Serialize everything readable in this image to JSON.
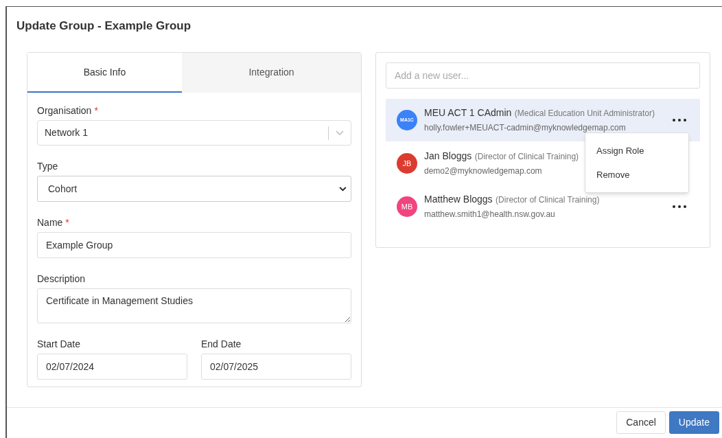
{
  "dialog": {
    "title": "Update Group - Example Group"
  },
  "tabs": [
    {
      "label": "Basic Info",
      "selected": true
    },
    {
      "label": "Integration",
      "selected": false
    }
  ],
  "form": {
    "organisation": {
      "label": "Organisation",
      "required_mark": "*",
      "value": "Network 1"
    },
    "type": {
      "label": "Type",
      "value": "Cohort"
    },
    "name": {
      "label": "Name",
      "required_mark": "*",
      "value": "Example Group"
    },
    "description": {
      "label": "Description",
      "value": "Certificate in Management Studies"
    },
    "start_date": {
      "label": "Start Date",
      "value": "02/07/2024"
    },
    "end_date": {
      "label": "End Date",
      "value": "02/07/2025"
    }
  },
  "user_search": {
    "placeholder": "Add a new user..."
  },
  "users": [
    {
      "initials": "MA1C",
      "color": "#3b82f6",
      "name": "MEU ACT 1 CAdmin",
      "role": "(Medical Education Unit Administrator)",
      "email": "holly.fowler+MEUACT-cadmin@myknowledgemap.com",
      "selected": true,
      "menu_button": true
    },
    {
      "initials": "JB",
      "color": "#dc3b2f",
      "name": "Jan Bloggs",
      "role": "(Director of Clinical Training)",
      "email": "demo2@myknowledgemap.com",
      "selected": false,
      "menu_button": false
    },
    {
      "initials": "MB",
      "color": "#f0457f",
      "name": "Matthew Bloggs",
      "role": "(Director of Clinical Training)",
      "email": "matthew.smith1@health.nsw.gov.au",
      "selected": false,
      "menu_button": true
    }
  ],
  "context_menu": {
    "items": [
      "Assign Role",
      "Remove"
    ]
  },
  "buttons": [
    {
      "label": "Cancel",
      "kind": "secondary"
    },
    {
      "label": "Update",
      "kind": "primary"
    }
  ]
}
